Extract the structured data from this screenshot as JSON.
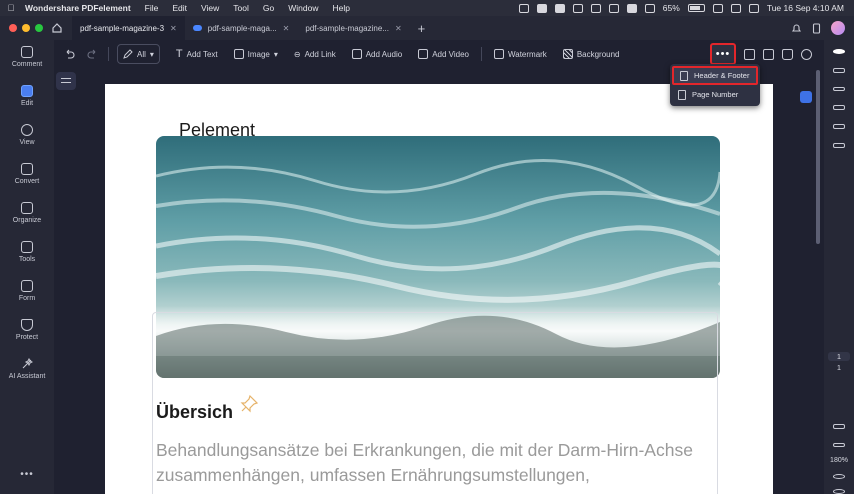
{
  "menubar": {
    "app_name": "Wondershare PDFelement",
    "items": [
      "File",
      "Edit",
      "View",
      "Tool",
      "Go",
      "Window",
      "Help"
    ],
    "battery": "65%",
    "datetime": "Tue 16 Sep  4:10 AM"
  },
  "tabs": [
    {
      "label": "pdf-sample-magazine-3",
      "active": true
    },
    {
      "label": "pdf-sample-maga...",
      "active": false
    },
    {
      "label": "pdf-sample-magazine...",
      "active": false
    }
  ],
  "sidebar": {
    "items": [
      {
        "label": "Comment",
        "icon": "comment-icon"
      },
      {
        "label": "Edit",
        "icon": "edit-icon",
        "active": true
      },
      {
        "label": "View",
        "icon": "view-icon"
      },
      {
        "label": "Convert",
        "icon": "convert-icon"
      },
      {
        "label": "Organize",
        "icon": "organize-icon"
      },
      {
        "label": "Tools",
        "icon": "tools-icon"
      },
      {
        "label": "Form",
        "icon": "form-icon"
      },
      {
        "label": "Protect",
        "icon": "protect-icon"
      },
      {
        "label": "AI Assistant",
        "icon": "ai-assistant-icon"
      }
    ],
    "more": "•••"
  },
  "toolbar": {
    "select_label": "All",
    "add_text": "Add Text",
    "image": "Image",
    "add_link": "Add Link",
    "add_audio": "Add Audio",
    "add_video": "Add Video",
    "watermark": "Watermark",
    "background": "Background",
    "more": "•••"
  },
  "dropdown": {
    "items": [
      "Header & Footer",
      "Page Number"
    ]
  },
  "right_panel": {
    "page_current": "1",
    "page_total": "1",
    "zoom": "180%"
  },
  "document": {
    "title": "Pelement",
    "heading": "Übersich",
    "body": "Behandlungsansätze bei Erkrankungen, die mit der Darm-Hirn-Achse zusammenhängen, umfassen Ernährungsumstellungen,"
  },
  "colors": {
    "accent": "#4a7ef0",
    "highlight_border": "#e3262b",
    "traffic_red": "#ff5f57",
    "traffic_yellow": "#febc2e",
    "traffic_green": "#28c840"
  }
}
